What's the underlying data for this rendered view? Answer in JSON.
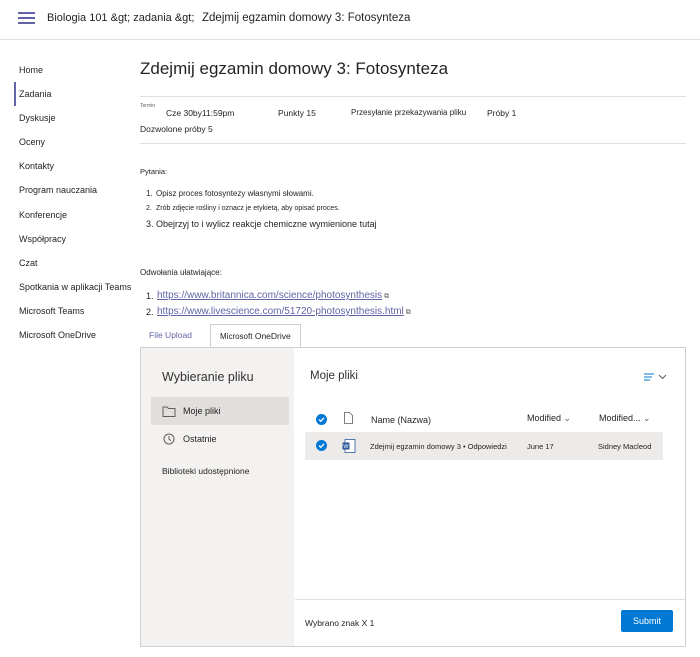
{
  "header": {
    "breadcrumb_1": "Biologia 101 &gt; zadania &gt;",
    "breadcrumb_2": "Zdejmij egzamin domowy 3: Fotosynteza"
  },
  "sidebar": {
    "items": [
      {
        "label": "Home"
      },
      {
        "label": "Zadania"
      },
      {
        "label": "Dyskusje"
      },
      {
        "label": "Oceny"
      },
      {
        "label": "Kontakty"
      },
      {
        "label": "Program nauczania"
      },
      {
        "label": "Konferencje"
      },
      {
        "label": "Współpracy"
      },
      {
        "label": "Czat"
      },
      {
        "label": "Spotkania w aplikacji Teams"
      },
      {
        "label": "Microsoft Teams"
      },
      {
        "label": "Microsoft OneDrive"
      }
    ]
  },
  "assignment": {
    "title": "Zdejmij egzamin domowy 3: Fotosynteza",
    "due_label": "Termin",
    "due_value": "Cze 30by11:59pm",
    "points": "Punkty 15",
    "submission": "Przesyłanie przekazywania pliku",
    "attempts": "Próby 1",
    "allowed_attempts": "Dozwolone próby 5"
  },
  "questions": {
    "label": "Pytania:",
    "items": [
      {
        "num": "1.",
        "text": "Opisz proces fotosyntezy własnymi słowami."
      },
      {
        "num": "2.",
        "text": "Zrób zdjęcie rośliny i oznacz je etykietą, aby opisać proces."
      },
      {
        "num": "3.",
        "text": "Obejrzyj to i wylicz reakcje chemiczne wymienione tutaj"
      }
    ]
  },
  "references": {
    "label": "Odwołania ułatwiające:",
    "links": [
      {
        "num": "1.",
        "url": "https://www.britannica.com/science/photosynthesis"
      },
      {
        "num": "2.",
        "url": "https://www.livescience.com/51720-photosynthesis.html"
      }
    ]
  },
  "tabs": {
    "upload": "File Upload",
    "onedrive_brand": "Microsoft",
    "onedrive": "OneDrive"
  },
  "picker": {
    "left_title": "Wybieranie pliku",
    "my_files": "Moje pliki",
    "recent": "Ostatnie",
    "shared_libraries": "Biblioteki udostępnione",
    "right_title": "Moje pliki",
    "col_name": "Name (Nazwa)",
    "col_modified": "Modified",
    "col_modified_by": "Modified...",
    "files": [
      {
        "name": "Zdejmij egzamin domowy 3 • Odpowiedzi",
        "modified": "June 17",
        "modified_by": "Sidney Macleod"
      }
    ],
    "selected_count": "Wybrano znak X 1",
    "submit": "Submit"
  },
  "colors": {
    "accent": "#6264a7",
    "primary_button": "#0078d4"
  }
}
